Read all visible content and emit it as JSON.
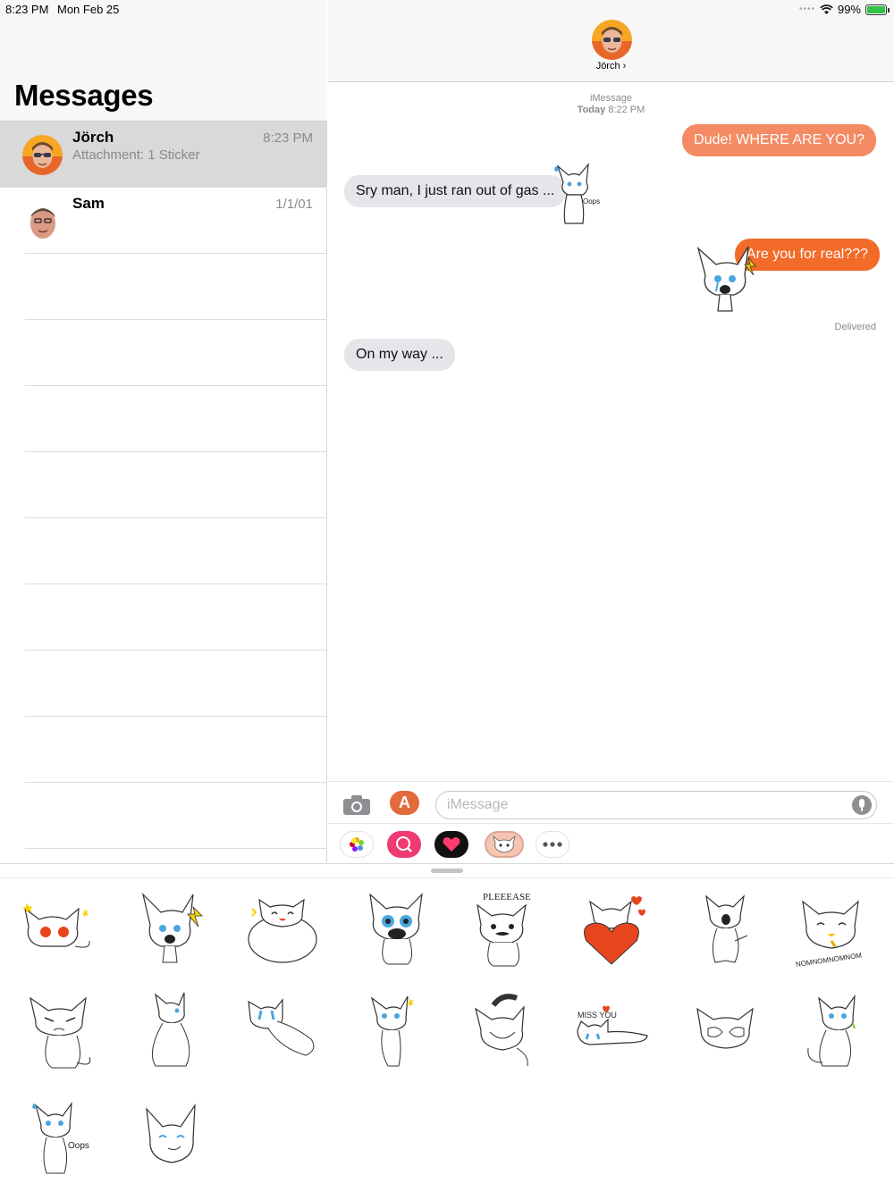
{
  "status_bar": {
    "time": "8:23 PM",
    "date": "Mon Feb 25",
    "battery": "99%",
    "wifi_icon": "wifi-icon"
  },
  "sidebar": {
    "title": "Messages",
    "conversations": [
      {
        "name": "Jörch",
        "time": "8:23 PM",
        "preview": "Attachment: 1 Sticker",
        "selected": true
      },
      {
        "name": "Sam",
        "time": "1/1/01",
        "preview": ""
      }
    ]
  },
  "chat": {
    "contact_name": "Jörch ›",
    "service": "iMessage",
    "timestamp_day": "Today",
    "timestamp_time": "8:22 PM",
    "messages": [
      {
        "text": "Dude! WHERE ARE YOU?",
        "direction": "out"
      },
      {
        "text": "Sry man, I just ran out of gas ...",
        "direction": "in"
      },
      {
        "text": "Are you for real???",
        "direction": "out"
      },
      {
        "text": "On my way ...",
        "direction": "in"
      }
    ],
    "delivered": "Delivered"
  },
  "composer": {
    "placeholder": "iMessage",
    "app_icons": [
      "camera-icon",
      "app-store-icon",
      "photos-icon",
      "image-search-icon",
      "digital-touch-icon",
      "cat-sticker-app-icon",
      "more-icon"
    ]
  },
  "sticker_drawer": {
    "sticker_names": [
      "dizzy-cat",
      "crying-cat",
      "laughing-fat-cat",
      "big-eyed-cat",
      "pleeease-cat",
      "heart-cat",
      "yawning-cat",
      "nom-nom-cat",
      "grumpy-cat",
      "sitting-back-cat",
      "lying-crying-cat",
      "dancing-cat",
      "grinning-cat",
      "miss-you-cat",
      "hiding-cat",
      "curious-cat",
      "oops-cat",
      "smirking-cat"
    ],
    "sticker_text": {
      "pleeease": "PLEEEASE",
      "nomnom": "NOMNOMNOMNOM",
      "missyou": "MISS YOU",
      "oops": "Oops"
    }
  },
  "colors": {
    "out_bubble": "#f58b65",
    "out_bubble_strong": "#f26b28",
    "in_bubble": "#e5e5ea",
    "selected_row": "#d9d9d9"
  }
}
